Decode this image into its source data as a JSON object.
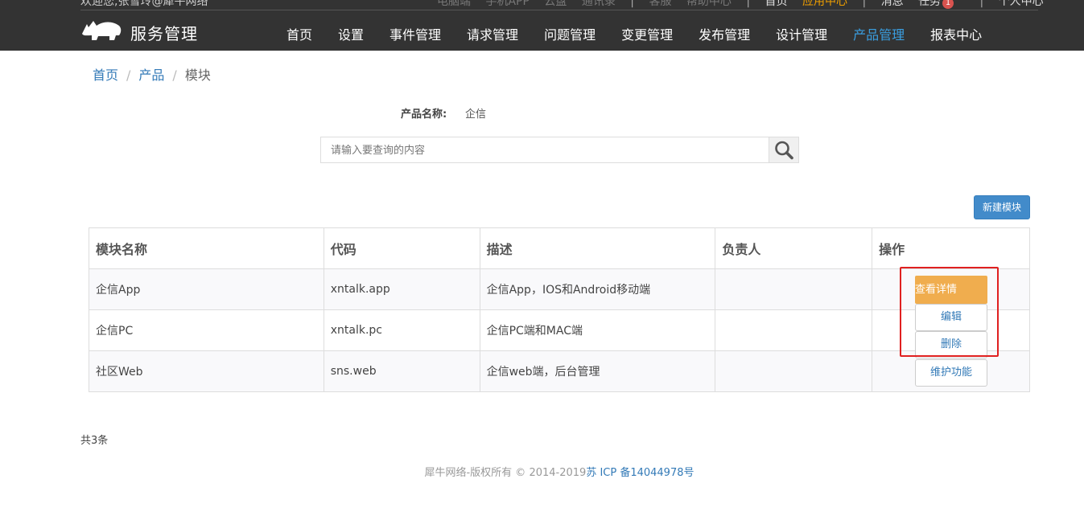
{
  "topbar": {
    "welcome": "欢迎您,张雪玲@犀牛网络",
    "links": [
      "电脑端",
      "手机APP",
      "云盘",
      "通讯录"
    ],
    "links2": [
      "客服",
      "帮助中心"
    ],
    "home": "首页",
    "app_center": "应用中心",
    "messages": "消息",
    "tasks": "任务",
    "task_count": "1",
    "personal": "个人中心"
  },
  "logo": {
    "text": "服务管理",
    "icon": "rhino-logo-icon"
  },
  "nav": {
    "items": [
      "首页",
      "设置",
      "事件管理",
      "请求管理",
      "问题管理",
      "变更管理",
      "发布管理",
      "设计管理",
      "产品管理",
      "报表中心"
    ],
    "active": "产品管理",
    "active_color": "#3a9ee0"
  },
  "breadcrumb": {
    "home": "首页",
    "product": "产品",
    "current": "模块",
    "separator": "/"
  },
  "product": {
    "label": "产品名称:",
    "value": "企信"
  },
  "search": {
    "placeholder": "请输入要查询的内容",
    "value": "",
    "icon": "search-icon"
  },
  "actions": {
    "new_module": "新建模块"
  },
  "table": {
    "headers": [
      "模块名称",
      "代码",
      "描述",
      "负责人",
      "操作"
    ],
    "rows": [
      {
        "name": "企信App",
        "code": "xntalk.app",
        "desc": "企信App，IOS和Android移动端",
        "owner": ""
      },
      {
        "name": "企信PC",
        "code": "xntalk.pc",
        "desc": "企信PC端和MAC端",
        "owner": ""
      },
      {
        "name": "社区Web",
        "code": "sns.web",
        "desc": "企信web端，后台管理",
        "owner": ""
      }
    ]
  },
  "op_menu": {
    "main": "查看详情",
    "items": [
      "编辑",
      "删除",
      "维护功能"
    ],
    "main_color": "#f0ad4e",
    "highlight_color": "#e02020"
  },
  "summary": {
    "total": "共3条"
  },
  "footer": {
    "copyright": "犀牛网络-版权所有 © 2014-2019",
    "icp": "苏 ICP 备14044978号"
  }
}
